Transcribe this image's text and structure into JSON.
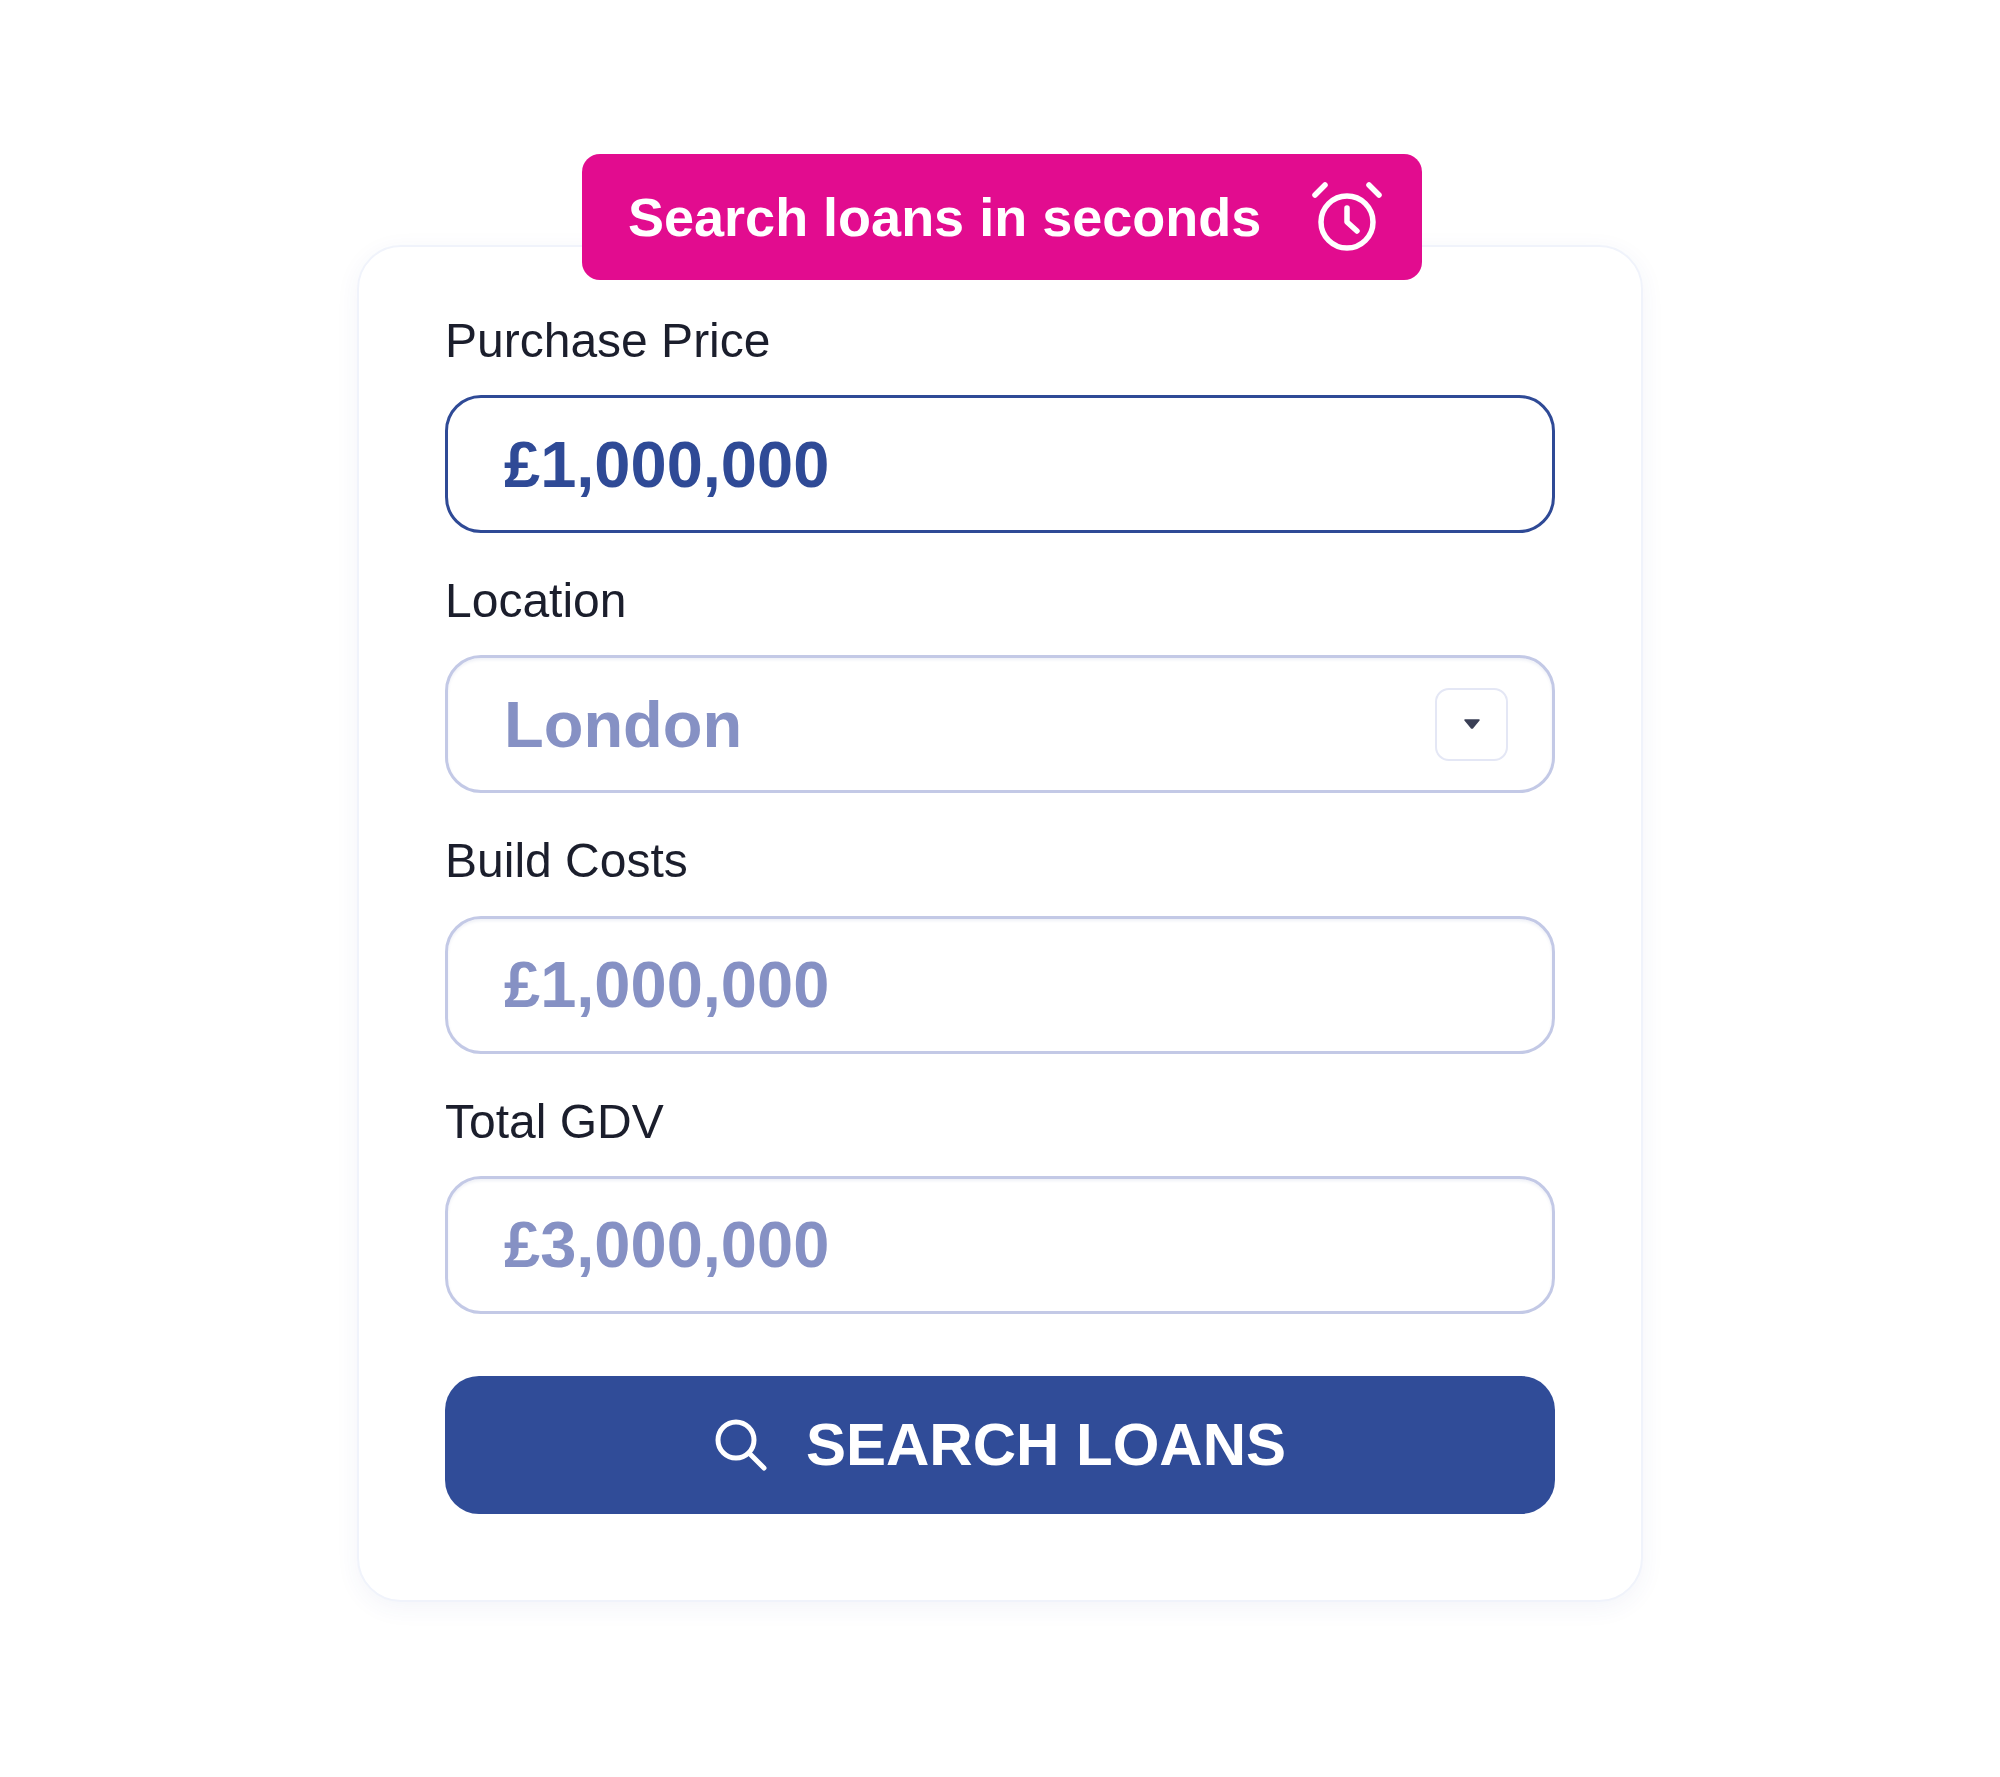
{
  "banner": {
    "text": "Search loans in seconds"
  },
  "fields": [
    {
      "kind": "text",
      "label": "Purchase Price",
      "value": "£1,000,000",
      "focused": true
    },
    {
      "kind": "select",
      "label": "Location",
      "placeholder": "London",
      "focused": false
    },
    {
      "kind": "text",
      "label": "Build Costs",
      "placeholder": "£1,000,000",
      "focused": false
    },
    {
      "kind": "text",
      "label": "Total GDV",
      "placeholder": "£3,000,000",
      "focused": false
    }
  ],
  "button": {
    "label": "SEARCH LOANS"
  }
}
